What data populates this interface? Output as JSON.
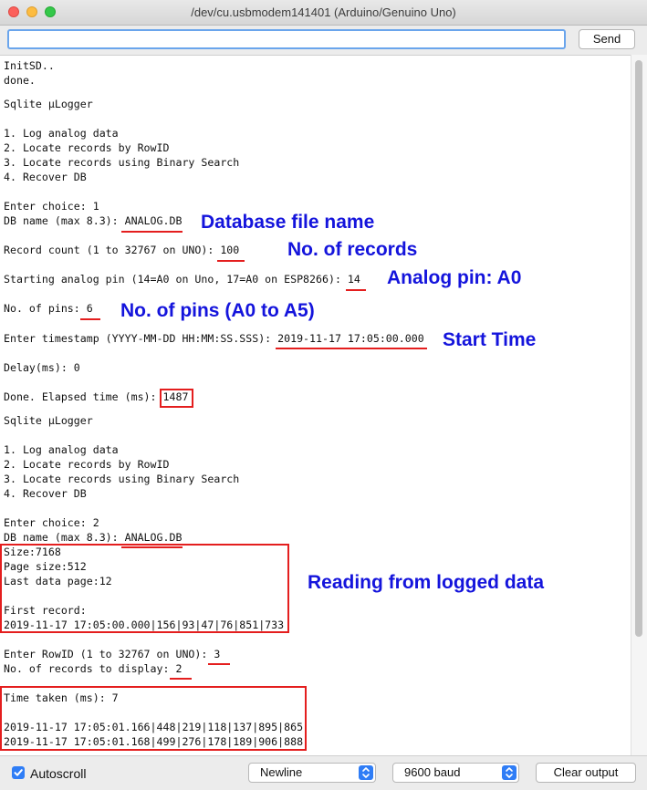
{
  "window": {
    "title": "/dev/cu.usbmodem141401 (Arduino/Genuino Uno)"
  },
  "toolbar": {
    "input_value": "",
    "send_label": "Send"
  },
  "console": {
    "lines": [
      "InitSD..",
      "done.",
      "Sqlite µLogger",
      "1. Log analog data",
      "2. Locate records by RowID",
      "3. Locate records using Binary Search",
      "4. Recover DB",
      "Enter choice: 1",
      "DB name (max 8.3): ANALOG.DB",
      "Record count (1 to 32767 on UNO): 100",
      "Starting analog pin (14=A0 on Uno, 17=A0 on ESP8266): 14",
      "No. of pins: 6",
      "Enter timestamp (YYYY-MM-DD HH:MM:SS.SSS): 2019-11-17 17:05:00.000",
      "Delay(ms): 0",
      "Done. Elapsed time (ms): 1487",
      "Sqlite µLogger",
      "1. Log analog data",
      "2. Locate records by RowID",
      "3. Locate records using Binary Search",
      "4. Recover DB",
      "Enter choice: 2",
      "DB name (max 8.3): ANALOG.DB",
      "Size:7168",
      "Page size:512",
      "Last data page:12",
      "First record:",
      "2019-11-17 17:05:00.000|156|93|47|76|851|733",
      "Enter RowID (1 to 32767 on UNO): 3",
      "No. of records to display: 2",
      "Time taken (ms): 7",
      "2019-11-17 17:05:01.166|448|219|118|137|895|865",
      "2019-11-17 17:05:01.168|499|276|178|189|906|888"
    ]
  },
  "annotations": {
    "db_file_name": "Database file name",
    "no_of_records": "No. of records",
    "analog_pin": "Analog pin: A0",
    "no_of_pins": "No. of pins (A0 to A5)",
    "start_time": "Start Time",
    "reading_logged": "Reading from logged data",
    "accent_color": "#1414dc",
    "highlight_color": "#e41e1e"
  },
  "footer": {
    "autoscroll_label": "Autoscroll",
    "autoscroll_checked": true,
    "line_ending": "Newline",
    "baud_rate": "9600 baud",
    "clear_label": "Clear output"
  }
}
